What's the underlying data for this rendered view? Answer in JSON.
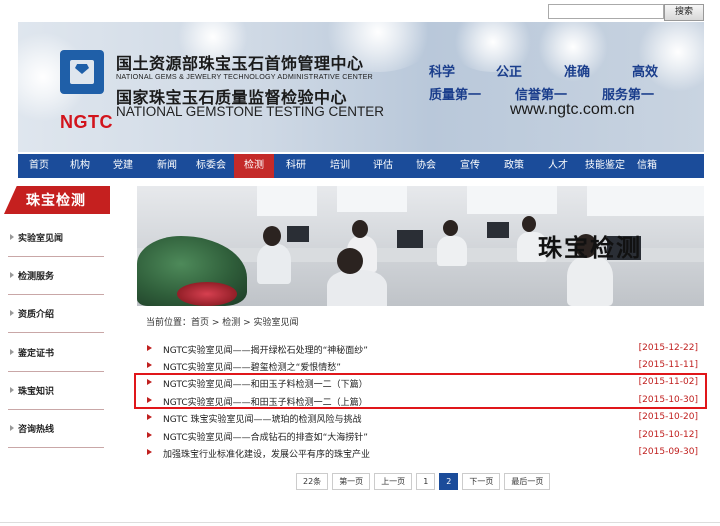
{
  "search": {
    "placeholder": "",
    "button_label": "搜索"
  },
  "banner": {
    "logo_text": "NGTC",
    "title_cn_1": "国土资源部珠宝玉石首饰管理中心",
    "title_en_1": "NATIONAL GEMS & JEWELRY TECHNOLOGY ADMINISTRATIVE CENTER",
    "title_cn_2": "国家珠宝玉石质量监督检验中心",
    "title_en_2": "NATIONAL GEMSTONE TESTING CENTER",
    "slogans": [
      "科学",
      "公正",
      "准确",
      "高效",
      "质量第一",
      "信誉第一",
      "服务第一"
    ],
    "website": "www.ngtc.com.cn"
  },
  "nav": {
    "items": [
      "首页",
      "机构",
      "党建",
      "新闻",
      "标委会",
      "检测",
      "科研",
      "培训",
      "评估",
      "协会",
      "宣传",
      "政策",
      "人才",
      "技能鉴定",
      "信箱"
    ],
    "active_index": 5
  },
  "sidebar": {
    "title": "珠宝检测",
    "items": [
      "实验室见闻",
      "检测服务",
      "资质介绍",
      "鉴定证书",
      "珠宝知识",
      "咨询热线"
    ]
  },
  "photo": {
    "overlay_text": "珠宝检测"
  },
  "breadcrumb": {
    "text": "当前位置：首页 > 检测 > 实验室见闻"
  },
  "list": {
    "rows": [
      {
        "title": "NGTC实验室见闻——揭开绿松石处理的“神秘面纱”",
        "date": "[2015-12-22]"
      },
      {
        "title": "NGTC实验室见闻——碧玺检测之“爱恨情愁”",
        "date": "[2015-11-11]"
      },
      {
        "title": "NGTC实验室见闻——和田玉子料检测一二（下篇）",
        "date": "[2015-11-02]"
      },
      {
        "title": "NGTC实验室见闻——和田玉子料检测一二（上篇）",
        "date": "[2015-10-30]"
      },
      {
        "title": "NGTC 珠宝实验室见闻——琥珀的检测风险与挑战",
        "date": "[2015-10-20]"
      },
      {
        "title": "NGTC实验室见闻——合成钻石的排查如“大海捞针”",
        "date": "[2015-10-12]"
      },
      {
        "title": "加强珠宝行业标准化建设，发展公平有序的珠宝产业",
        "date": "[2015-09-30]"
      }
    ]
  },
  "pager": {
    "total": "22条",
    "first": "第一页",
    "prev": "上一页",
    "page1": "1",
    "page2": "2",
    "next": "下一页",
    "last": "最后一页",
    "current_page": 2
  },
  "colors": {
    "nav_bg": "#1b4c9a",
    "accent_red": "#c5201f",
    "highlight_border": "#e0161a"
  }
}
